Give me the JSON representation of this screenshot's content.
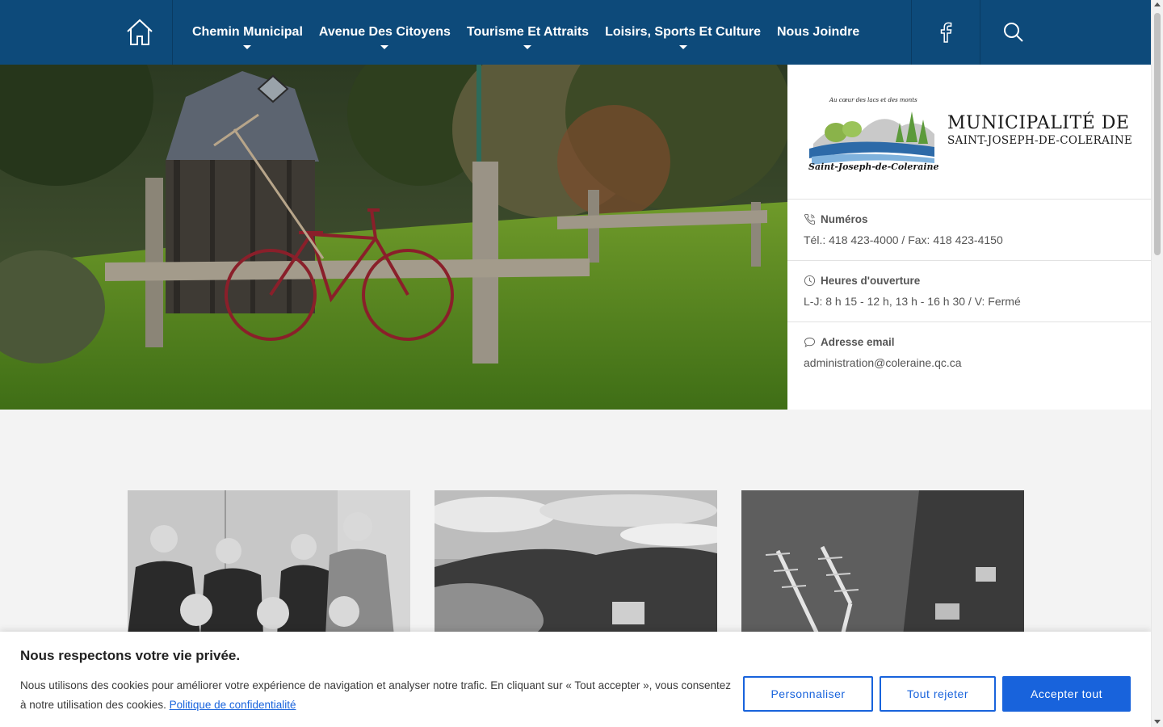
{
  "nav": {
    "home_icon": "home-icon",
    "items": [
      {
        "label": "Chemin Municipal",
        "has_dropdown": true
      },
      {
        "label": "Avenue Des Citoyens",
        "has_dropdown": true
      },
      {
        "label": "Tourisme Et Attraits",
        "has_dropdown": true
      },
      {
        "label": "Loisirs, Sports Et Culture",
        "has_dropdown": true
      },
      {
        "label": "Nous Joindre",
        "has_dropdown": false
      }
    ],
    "facebook_icon": "facebook-icon",
    "search_icon": "search-icon"
  },
  "logo": {
    "arc_text": "Au cœur des lacs et des monts",
    "script_text": "Saint-Joseph-de-Coleraine",
    "title_line1": "MUNICIPALITÉ DE",
    "title_line2": "SAINT-JOSEPH-DE-COLERAINE"
  },
  "info": [
    {
      "icon": "phone-icon",
      "heading": "Numéros",
      "value": "Tél.: 418 423-4000 / Fax: 418 423-4150"
    },
    {
      "icon": "clock-icon",
      "heading": "Heures d'ouverture",
      "value": "L-J: 8 h 15 - 12 h, 13 h - 16 h 30 / V: Fermé"
    },
    {
      "icon": "chat-icon",
      "heading": "Adresse email",
      "value": "administration@coleraine.qc.ca"
    }
  ],
  "cookie": {
    "title": "Nous respectons votre vie privée.",
    "text": "Nous utilisons des cookies pour améliorer votre expérience de navigation et analyser notre trafic. En cliquant sur « Tout accepter », vous consentez à notre utilisation des cookies.",
    "link": "Politique de confidentialité",
    "buttons": {
      "customize": "Personnaliser",
      "reject": "Tout rejeter",
      "accept": "Accepter tout"
    }
  },
  "colors": {
    "nav_bg": "#0d4a7a",
    "accent": "#1863dc"
  }
}
